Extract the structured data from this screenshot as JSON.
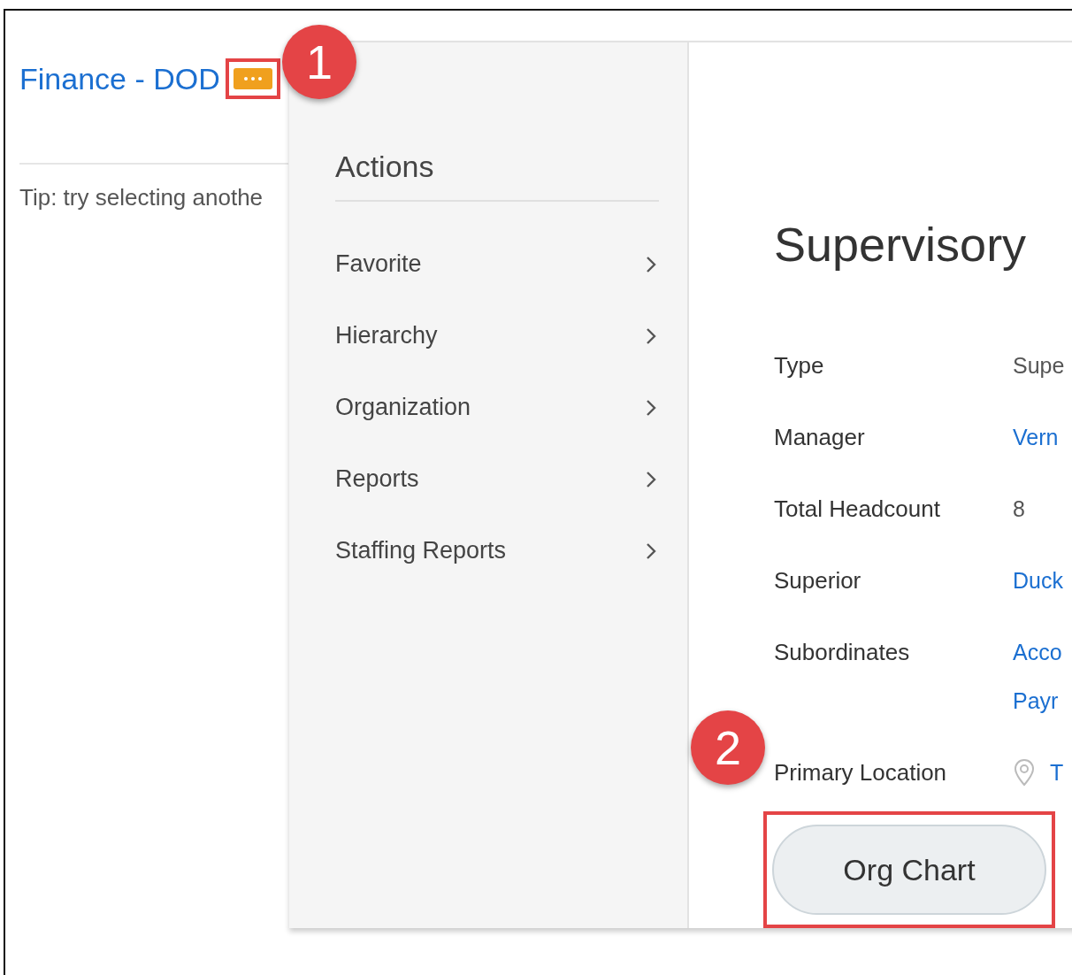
{
  "page": {
    "title": "Finance - DOD",
    "tip": "Tip: try selecting anothe"
  },
  "actions_menu": {
    "heading": "Actions",
    "items": [
      {
        "label": "Favorite"
      },
      {
        "label": "Hierarchy"
      },
      {
        "label": "Organization"
      },
      {
        "label": "Reports"
      },
      {
        "label": "Staffing Reports"
      }
    ]
  },
  "details": {
    "heading": "Supervisory",
    "fields": [
      {
        "label": "Type",
        "values": [
          {
            "kind": "text",
            "text": "Supe"
          }
        ]
      },
      {
        "label": "Manager",
        "values": [
          {
            "kind": "link",
            "text": "Vern"
          }
        ]
      },
      {
        "label": "Total Headcount",
        "values": [
          {
            "kind": "text",
            "text": "8"
          }
        ]
      },
      {
        "label": "Superior",
        "values": [
          {
            "kind": "link",
            "text": "Duck"
          }
        ]
      },
      {
        "label": "Subordinates",
        "values": [
          {
            "kind": "link",
            "text": "Acco"
          },
          {
            "kind": "link",
            "text": "Payr"
          }
        ]
      },
      {
        "label": "Primary Location",
        "values": [
          {
            "kind": "location",
            "text": "T"
          }
        ]
      }
    ],
    "button": "Org Chart"
  },
  "annotations": [
    {
      "number": "1"
    },
    {
      "number": "2"
    }
  ]
}
